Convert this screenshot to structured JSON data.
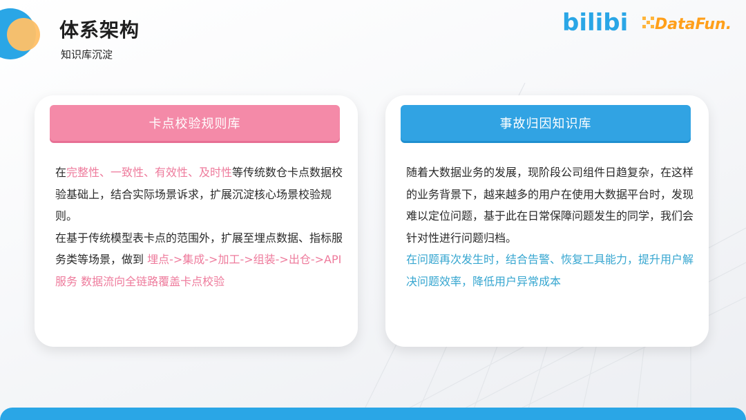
{
  "header": {
    "title": "体系架构",
    "subtitle": "知识库沉淀"
  },
  "logos": {
    "bilibili": "bilibili",
    "datafun": "DataFun."
  },
  "colors": {
    "accent_blue": "#2aa6e6",
    "accent_orange": "#ffc067",
    "pink": "#f48aa8",
    "teal": "#36a6d0"
  },
  "left_card": {
    "header": "卡点校验规则库",
    "p1_a": "在",
    "p1_highlight": "完整性、一致性、有效性、及时性",
    "p1_b": "等传统数仓卡点数据校验基础上，结合实际场景诉求，扩展沉淀核心场景校验规则。",
    "p2_a": "在基于传统模型表卡点的范围外，扩展至埋点数据、指标服务类等场景，做到 ",
    "p2_highlight": "埋点->集成->加工->组装->出仓->API服务 数据流向全链路覆盖卡点校验"
  },
  "right_card": {
    "header": "事故归因知识库",
    "p1": "随着大数据业务的发展，现阶段公司组件日趋复杂，在这样的业务背景下，越来越多的用户在使用大数据平台时，发现难以定位问题，基于此在日常保障问题发生的同学，我们会针对性进行问题归档。",
    "p2": "在问题再次发生时，结合告警、恢复工具能力，提升用户解决问题效率，降低用户异常成本"
  }
}
